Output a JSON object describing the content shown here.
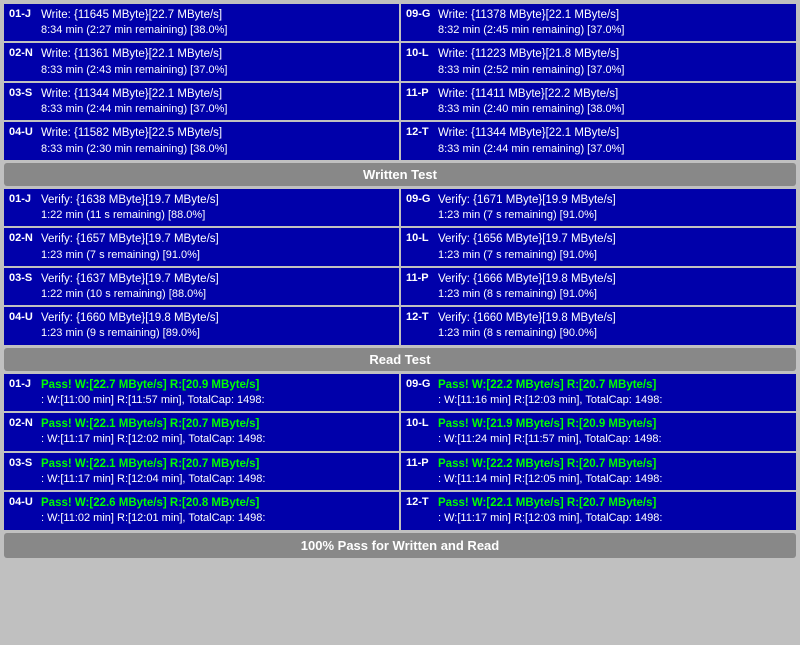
{
  "sections": {
    "write": {
      "rows_left": [
        {
          "id": "01-J",
          "line1": "Write: {11645 MByte}[22.7 MByte/s]",
          "line2": "8:34 min (2:27 min remaining)  [38.0%]"
        },
        {
          "id": "02-N",
          "line1": "Write: {11361 MByte}[22.1 MByte/s]",
          "line2": "8:33 min (2:43 min remaining)  [37.0%]"
        },
        {
          "id": "03-S",
          "line1": "Write: {11344 MByte}[22.1 MByte/s]",
          "line2": "8:33 min (2:44 min remaining)  [37.0%]"
        },
        {
          "id": "04-U",
          "line1": "Write: {11582 MByte}[22.5 MByte/s]",
          "line2": "8:33 min (2:30 min remaining)  [38.0%]"
        }
      ],
      "rows_right": [
        {
          "id": "09-G",
          "line1": "Write: {11378 MByte}[22.1 MByte/s]",
          "line2": "8:32 min (2:45 min remaining)  [37.0%]"
        },
        {
          "id": "10-L",
          "line1": "Write: {11223 MByte}[21.8 MByte/s]",
          "line2": "8:33 min (2:52 min remaining)  [37.0%]"
        },
        {
          "id": "11-P",
          "line1": "Write: {11411 MByte}[22.2 MByte/s]",
          "line2": "8:33 min (2:40 min remaining)  [38.0%]"
        },
        {
          "id": "12-T",
          "line1": "Write: {11344 MByte}[22.1 MByte/s]",
          "line2": "8:33 min (2:44 min remaining)  [37.0%]"
        }
      ]
    },
    "written_test_label": "Written Test",
    "verify": {
      "rows_left": [
        {
          "id": "01-J",
          "line1": "Verify: {1638 MByte}[19.7 MByte/s]",
          "line2": "1:22 min (11 s remaining)   [88.0%]"
        },
        {
          "id": "02-N",
          "line1": "Verify: {1657 MByte}[19.7 MByte/s]",
          "line2": "1:23 min (7 s remaining)   [91.0%]"
        },
        {
          "id": "03-S",
          "line1": "Verify: {1637 MByte}[19.7 MByte/s]",
          "line2": "1:22 min (10 s remaining)   [88.0%]"
        },
        {
          "id": "04-U",
          "line1": "Verify: {1660 MByte}[19.8 MByte/s]",
          "line2": "1:23 min (9 s remaining)   [89.0%]"
        }
      ],
      "rows_right": [
        {
          "id": "09-G",
          "line1": "Verify: {1671 MByte}[19.9 MByte/s]",
          "line2": "1:23 min (7 s remaining)   [91.0%]"
        },
        {
          "id": "10-L",
          "line1": "Verify: {1656 MByte}[19.7 MByte/s]",
          "line2": "1:23 min (7 s remaining)   [91.0%]"
        },
        {
          "id": "11-P",
          "line1": "Verify: {1666 MByte}[19.8 MByte/s]",
          "line2": "1:23 min (8 s remaining)   [91.0%]"
        },
        {
          "id": "12-T",
          "line1": "Verify: {1660 MByte}[19.8 MByte/s]",
          "line2": "1:23 min (8 s remaining)   [90.0%]"
        }
      ]
    },
    "read_test_label": "Read Test",
    "pass": {
      "rows_left": [
        {
          "id": "01-J",
          "line1": "Pass! W:[22.7 MByte/s] R:[20.9 MByte/s]",
          "line2": ": W:[11:00 min] R:[11:57 min], TotalCap: 1498:"
        },
        {
          "id": "02-N",
          "line1": "Pass! W:[22.1 MByte/s] R:[20.7 MByte/s]",
          "line2": ": W:[11:17 min] R:[12:02 min], TotalCap: 1498:"
        },
        {
          "id": "03-S",
          "line1": "Pass! W:[22.1 MByte/s] R:[20.7 MByte/s]",
          "line2": ": W:[11:17 min] R:[12:04 min], TotalCap: 1498:"
        },
        {
          "id": "04-U",
          "line1": "Pass! W:[22.6 MByte/s] R:[20.8 MByte/s]",
          "line2": ": W:[11:02 min] R:[12:01 min], TotalCap: 1498:"
        }
      ],
      "rows_right": [
        {
          "id": "09-G",
          "line1": "Pass! W:[22.2 MByte/s] R:[20.7 MByte/s]",
          "line2": ": W:[11:16 min] R:[12:03 min], TotalCap: 1498:"
        },
        {
          "id": "10-L",
          "line1": "Pass! W:[21.9 MByte/s] R:[20.9 MByte/s]",
          "line2": ": W:[11:24 min] R:[11:57 min], TotalCap: 1498:"
        },
        {
          "id": "11-P",
          "line1": "Pass! W:[22.2 MByte/s] R:[20.7 MByte/s]",
          "line2": ": W:[11:14 min] R:[12:05 min], TotalCap: 1498:"
        },
        {
          "id": "12-T",
          "line1": "Pass! W:[22.1 MByte/s] R:[20.7 MByte/s]",
          "line2": ": W:[11:17 min] R:[12:03 min], TotalCap: 1498:"
        }
      ]
    },
    "footer_label": "100% Pass for Written and Read"
  }
}
